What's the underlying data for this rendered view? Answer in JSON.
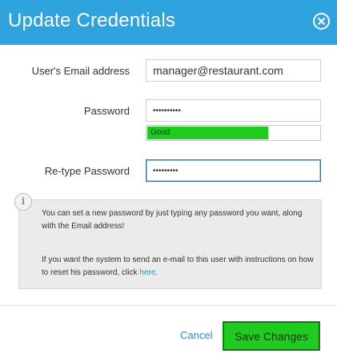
{
  "dialog": {
    "title": "Update Credentials"
  },
  "form": {
    "email": {
      "label": "User's Email address",
      "value": "manager@restaurant.com"
    },
    "password": {
      "label": "Password",
      "value": "••••••••••"
    },
    "strength": {
      "label": "Good",
      "level_percent": 70
    },
    "retype": {
      "label": "Re-type Password",
      "value": "•••••••••"
    }
  },
  "info": {
    "icon": "info-icon",
    "paragraph1": "You can set a new password by just typing any password you want, along with the Email address!",
    "paragraph2_prefix": "If you want the system to send an e-mail to this user with instructions on how to reset his password, click ",
    "paragraph2_link": "here",
    "paragraph2_suffix": "."
  },
  "actions": {
    "cancel_label": "Cancel",
    "save_label": "Save Changes"
  },
  "colors": {
    "header": "#2fa3dd",
    "accent_green": "#1fcb1f",
    "link": "#2a8fcc"
  }
}
